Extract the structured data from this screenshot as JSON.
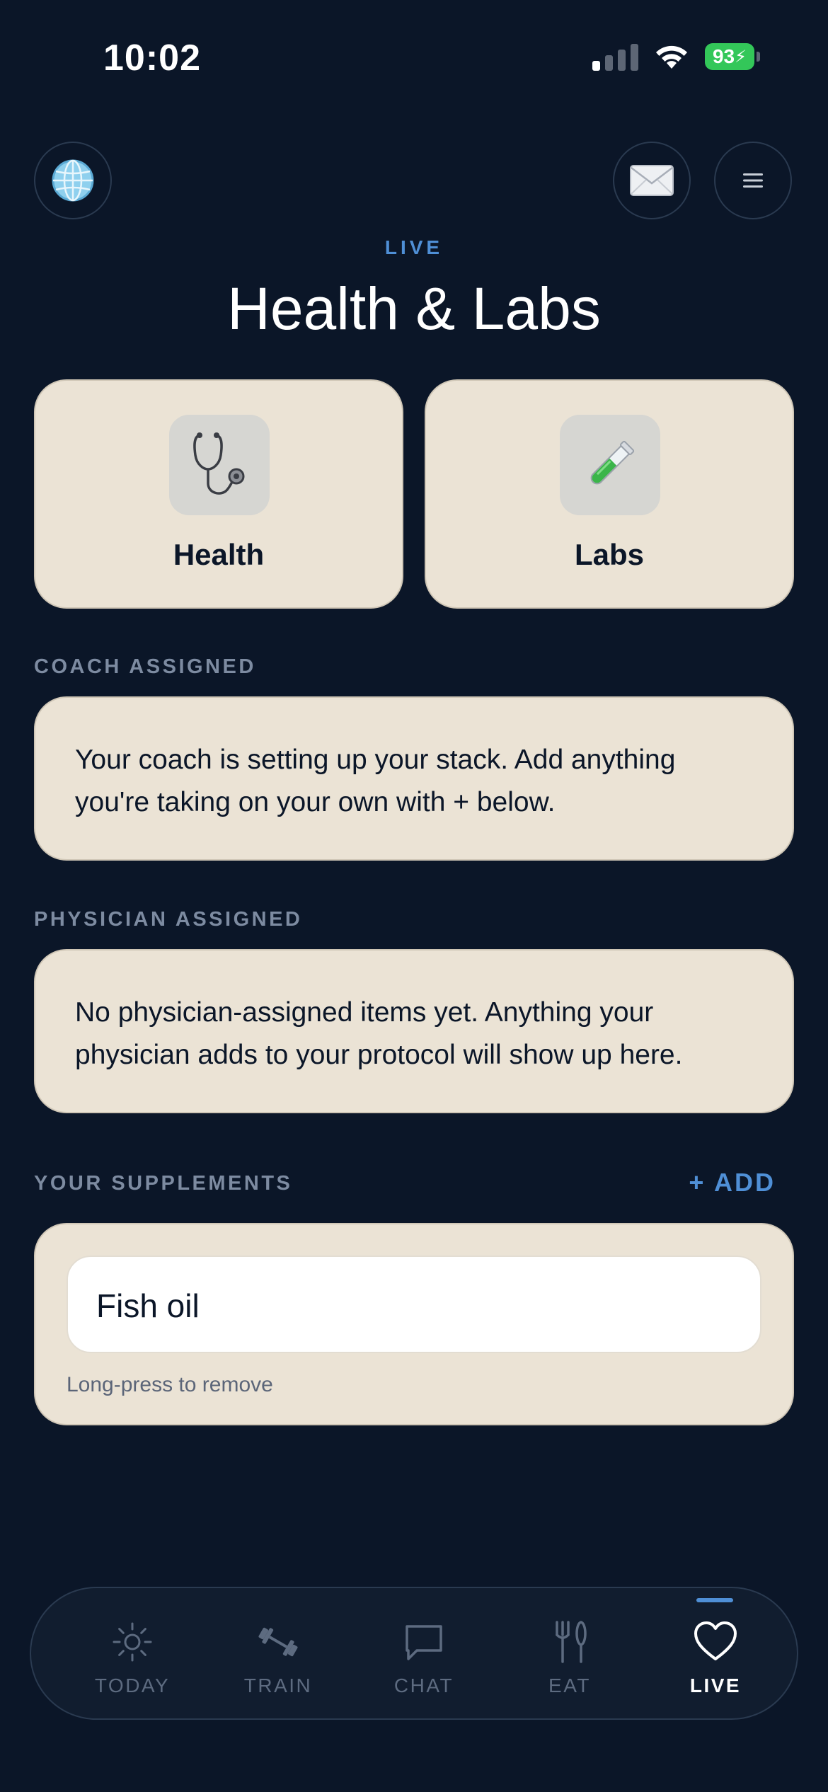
{
  "status": {
    "time": "10:02",
    "battery": "93"
  },
  "header": {
    "eyebrow": "LIVE",
    "title": "Health & Labs"
  },
  "tiles": [
    {
      "label": "Health",
      "icon": "stethoscope-icon"
    },
    {
      "label": "Labs",
      "icon": "test-tube-icon"
    }
  ],
  "coach": {
    "heading": "COACH ASSIGNED",
    "text": "Your coach is setting up your stack. Add anything you're taking on your own with + below."
  },
  "physician": {
    "heading": "PHYSICIAN ASSIGNED",
    "text": "No physician-assigned items yet. Anything your physician adds to your protocol will show up here."
  },
  "supplements": {
    "heading": "YOUR SUPPLEMENTS",
    "add_label": "+ ADD",
    "items": [
      "Fish oil"
    ],
    "hint": "Long-press to remove"
  },
  "tabs": [
    {
      "label": "TODAY",
      "icon": "sun-icon",
      "active": false
    },
    {
      "label": "TRAIN",
      "icon": "dumbbell-icon",
      "active": false
    },
    {
      "label": "CHAT",
      "icon": "chat-bubble-icon",
      "active": false
    },
    {
      "label": "EAT",
      "icon": "fork-knife-icon",
      "active": false
    },
    {
      "label": "LIVE",
      "icon": "heart-icon",
      "active": true
    }
  ],
  "colors": {
    "background": "#0b1628",
    "card": "#ebe3d5",
    "accent": "#4f8fd6",
    "battery": "#33c759"
  }
}
